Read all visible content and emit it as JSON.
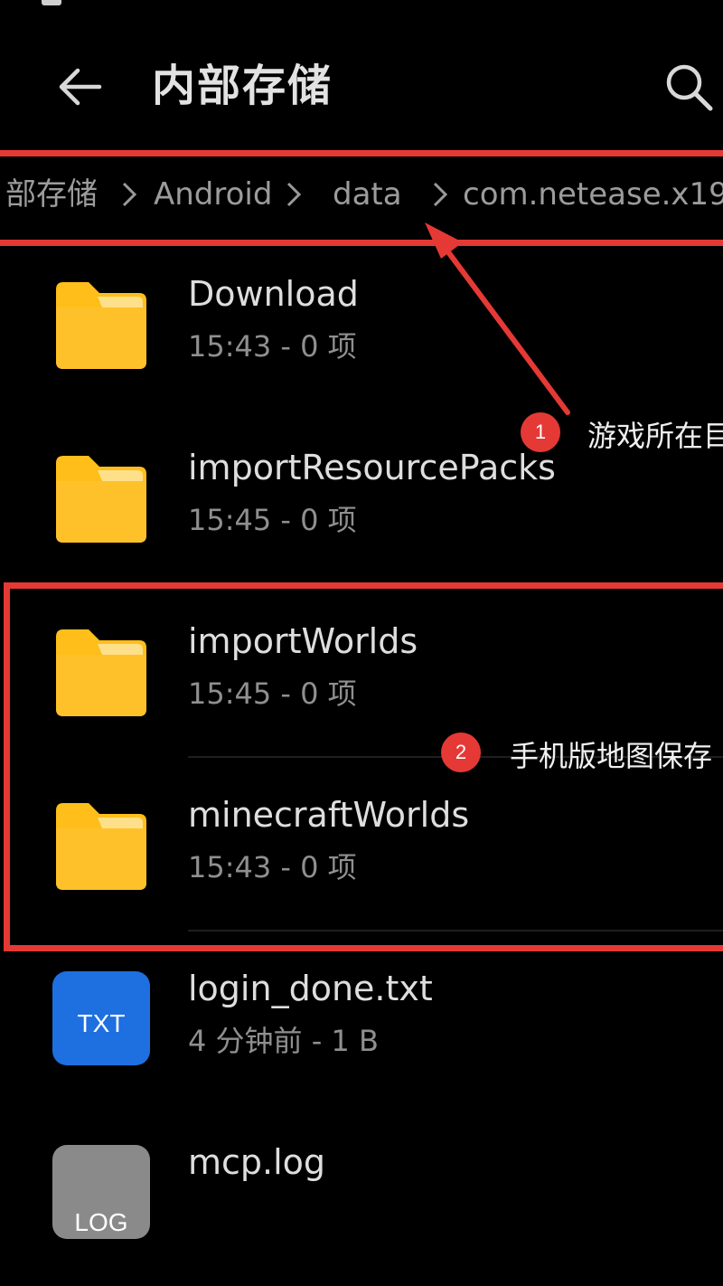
{
  "header": {
    "title": "内部存储"
  },
  "breadcrumb": {
    "items": [
      "部存储",
      "Android",
      "data",
      "com.netease.x19"
    ]
  },
  "files": [
    {
      "name": "Download",
      "meta": "15:43 - 0 项",
      "type": "folder"
    },
    {
      "name": "importResourcePacks",
      "meta": "15:45 - 0 项",
      "type": "folder"
    },
    {
      "name": "importWorlds",
      "meta": "15:45 - 0 项",
      "type": "folder"
    },
    {
      "name": "minecraftWorlds",
      "meta": "15:43 - 0 项",
      "type": "folder"
    },
    {
      "name": "login_done.txt",
      "meta": "4 分钟前 - 1 B",
      "type": "txt",
      "icon_label": "TXT"
    },
    {
      "name": "mcp.log",
      "meta": "",
      "type": "log",
      "icon_label": "LOG"
    }
  ],
  "annotations": [
    {
      "number": "1",
      "text": "游戏所在目"
    },
    {
      "number": "2",
      "text": "手机版地图保存"
    }
  ],
  "colors": {
    "background": "#000000",
    "folder": "#FFBE1A",
    "folder_tab": "#FFE08A",
    "txt_icon": "#1E6FE0",
    "log_icon": "#8A8A8A",
    "annotation_red": "#E53935"
  },
  "icons": {
    "back": "arrow-left-icon",
    "search": "search-icon",
    "folder": "folder-icon",
    "chevron": "chevron-right-icon"
  }
}
